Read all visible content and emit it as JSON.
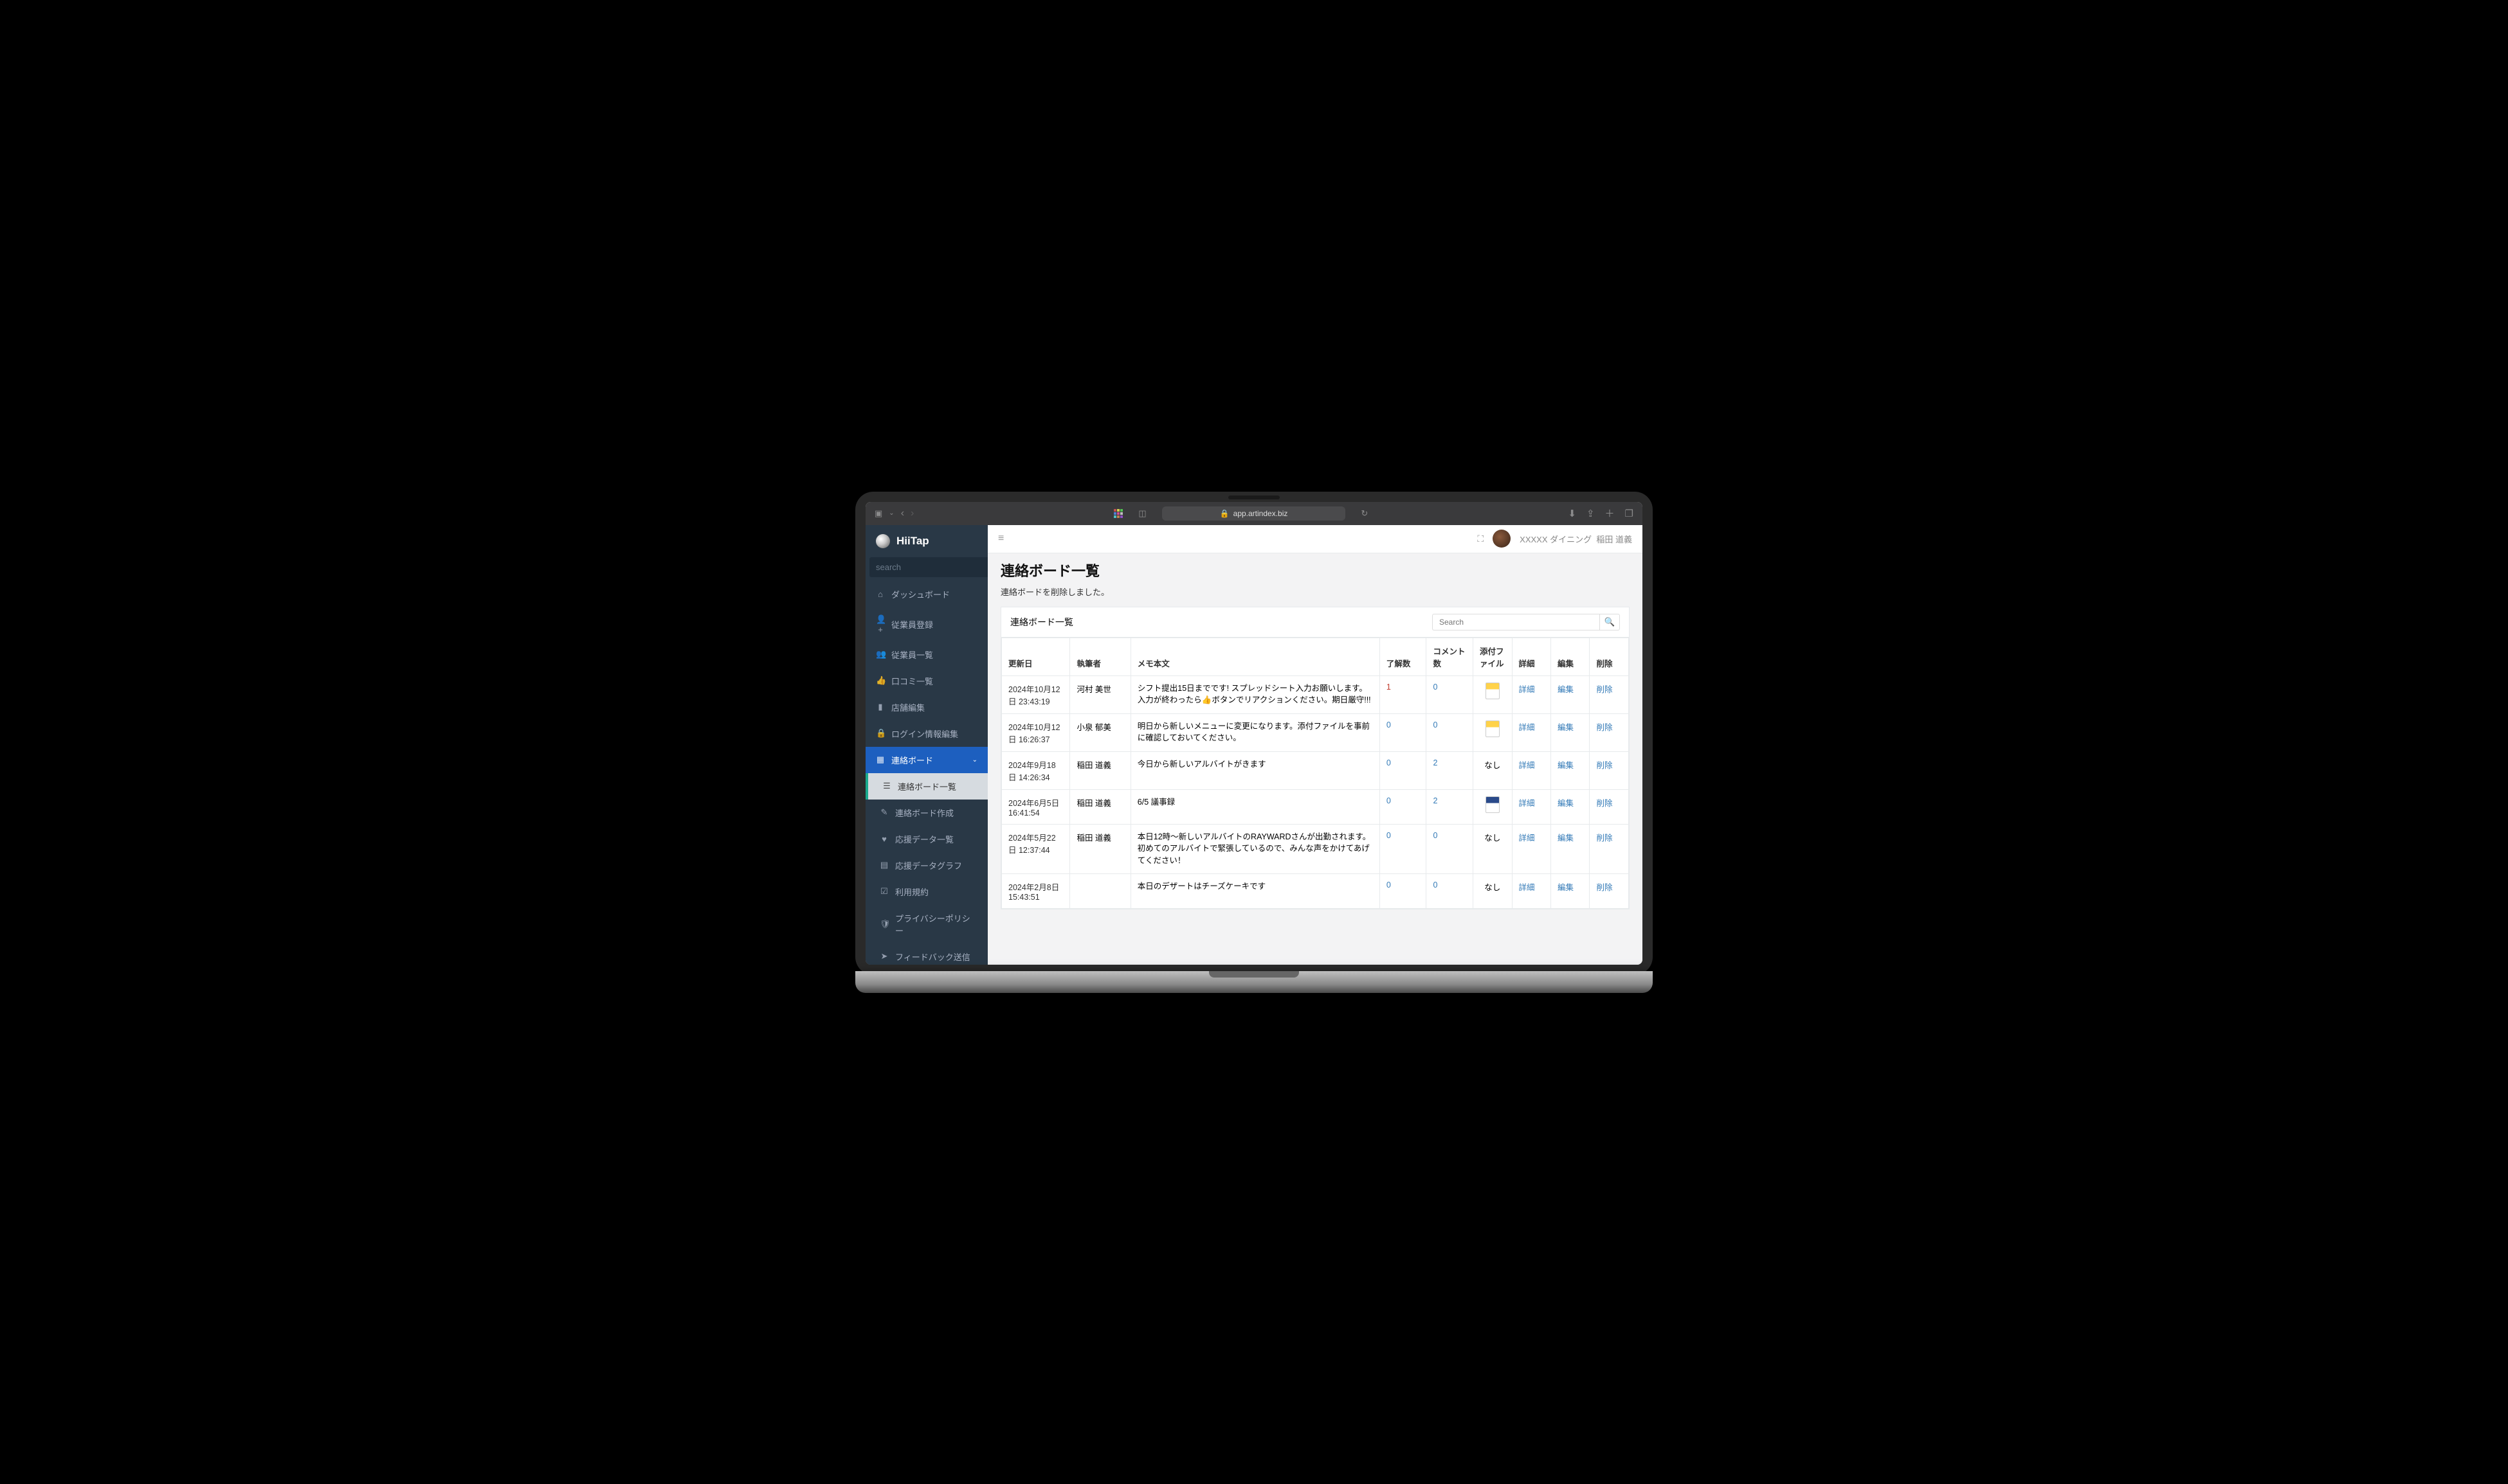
{
  "browser": {
    "url": "app.artindex.biz",
    "lock_icon": "🔒"
  },
  "brand": {
    "name": "HiiTap"
  },
  "sidebar": {
    "search_placeholder": "search",
    "items": [
      {
        "label": "ダッシュボード",
        "icon": "dashboard-icon"
      },
      {
        "label": "従業員登録",
        "icon": "user-plus-icon"
      },
      {
        "label": "従業員一覧",
        "icon": "users-icon"
      },
      {
        "label": "口コミ一覧",
        "icon": "thumbs-up-icon"
      },
      {
        "label": "店舗編集",
        "icon": "store-icon"
      },
      {
        "label": "ログイン情報編集",
        "icon": "lock-icon"
      },
      {
        "label": "連絡ボード",
        "icon": "board-icon",
        "expanded": true
      },
      {
        "label": "連絡ボード一覧",
        "icon": "list-icon",
        "sub": true,
        "active": true
      },
      {
        "label": "連絡ボード作成",
        "icon": "edit-icon",
        "sub": true
      },
      {
        "label": "応援データ一覧",
        "icon": "heart-icon",
        "sub": true
      },
      {
        "label": "応援データグラフ",
        "icon": "chart-icon",
        "sub": true
      },
      {
        "label": "利用規約",
        "icon": "check-icon",
        "sub": true
      },
      {
        "label": "プライバシーポリシー",
        "icon": "shield-icon",
        "sub": true
      },
      {
        "label": "フィードバック送信",
        "icon": "send-icon",
        "sub": true
      }
    ],
    "lang": "JA"
  },
  "topbar": {
    "company": "XXXXX ダイニング",
    "user": "稲田 道義"
  },
  "page": {
    "title": "連絡ボード一覧",
    "notice": "連絡ボードを削除しました。",
    "panel_title": "連絡ボード一覧",
    "search_placeholder": "Search"
  },
  "table": {
    "headers": {
      "date": "更新日",
      "author": "執筆者",
      "memo": "メモ本文",
      "ack": "了解数",
      "comments": "コメント数",
      "file": "添付ファイル",
      "detail": "詳細",
      "edit": "編集",
      "delete": "削除"
    },
    "action_labels": {
      "detail": "詳細",
      "edit": "編集",
      "delete": "削除"
    },
    "rows": [
      {
        "date": "2024年10月12日 23:43:19",
        "author": "河村 美世",
        "memo": "シフト提出15日までです! スプレッドシート入力お願いします。入力が終わったら👍ボタンでリアクションください。期日厳守!!!",
        "ack": "1",
        "ack_hot": true,
        "comments": "0",
        "file": "xls"
      },
      {
        "date": "2024年10月12日 16:26:37",
        "author": "小泉 郁美",
        "memo": "明日から新しいメニューに変更になります。添付ファイルを事前に確認しておいてください。",
        "ack": "0",
        "comments": "0",
        "file": "xls"
      },
      {
        "date": "2024年9月18日 14:26:34",
        "author": "稲田 道義",
        "memo": "今日から新しいアルバイトがきます",
        "ack": "0",
        "comments": "2",
        "file": "なし"
      },
      {
        "date": "2024年6月5日 16:41:54",
        "author": "稲田 道義",
        "memo": "6/5 議事録",
        "ack": "0",
        "comments": "2",
        "file": "docx"
      },
      {
        "date": "2024年5月22日 12:37:44",
        "author": "稲田 道義",
        "memo": "本日12時〜新しいアルバイトのRAYWARDさんが出勤されます。初めてのアルバイトで緊張しているので、みんな声をかけてあげてください！",
        "ack": "0",
        "comments": "0",
        "file": "なし"
      },
      {
        "date": "2024年2月8日 15:43:51",
        "author": "",
        "memo": "本日のデザートはチーズケーキです",
        "ack": "0",
        "comments": "0",
        "file": "なし"
      }
    ]
  }
}
